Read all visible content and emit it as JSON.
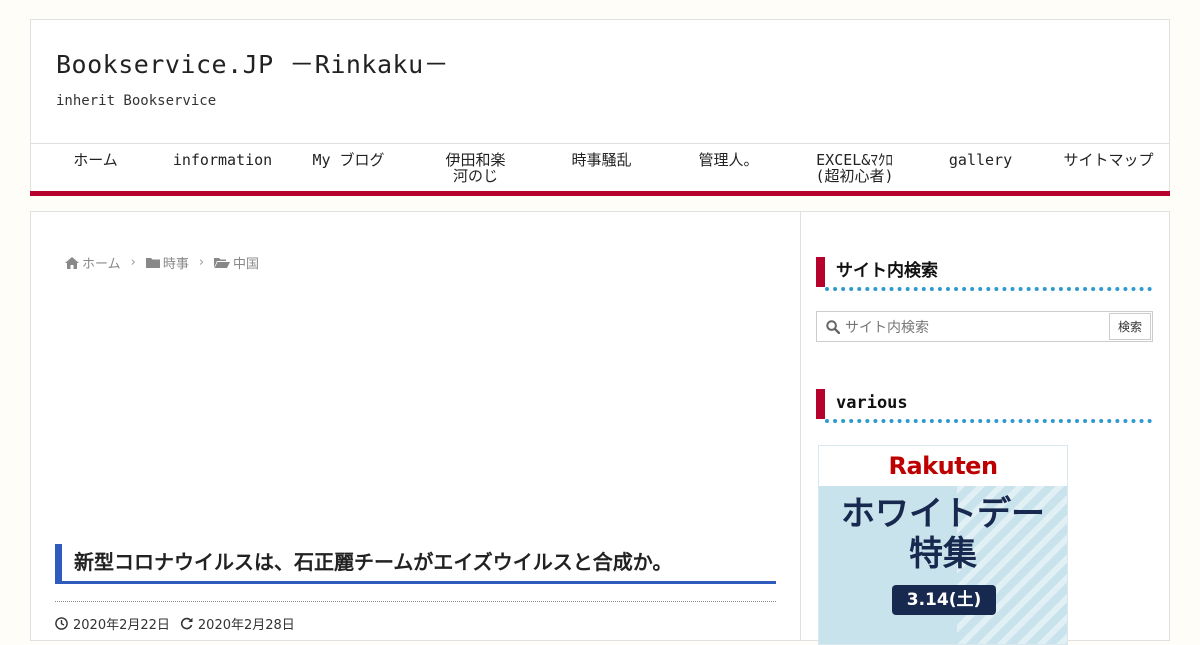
{
  "site": {
    "title": "Bookservice.JP －Rinkaku－",
    "tagline": "inherit Bookservice"
  },
  "nav": {
    "items": [
      {
        "lines": [
          "ホーム"
        ]
      },
      {
        "lines": [
          "information"
        ]
      },
      {
        "lines": [
          "My ブログ"
        ]
      },
      {
        "lines": [
          "伊田和楽",
          "河のじ"
        ]
      },
      {
        "lines": [
          "時事騒乱"
        ]
      },
      {
        "lines": [
          "管理人。"
        ]
      },
      {
        "lines": [
          "EXCEL&ﾏｸﾛ",
          "(超初心者)"
        ]
      },
      {
        "lines": [
          "gallery"
        ]
      },
      {
        "lines": [
          "サイトマップ"
        ]
      }
    ]
  },
  "breadcrumb": {
    "home": "ホーム",
    "category": "時事",
    "subcategory": "中国"
  },
  "post": {
    "title": "新型コロナウイルスは、石正麗チームがエイズウイルスと合成か。",
    "published": "2020年2月22日",
    "updated": "2020年2月28日"
  },
  "sidebar": {
    "search_title": "サイト内検索",
    "search_placeholder": "サイト内検索",
    "search_button": "検索",
    "various_title": "various"
  },
  "ad": {
    "brand": "Rakuten",
    "headline_line1": "ホワイトデー",
    "headline_line2": "特集",
    "date": "3.14(土)"
  },
  "colors": {
    "accent_red": "#b6012c",
    "accent_blue": "#2f5bbf",
    "dot_blue": "#2f9ad0"
  }
}
